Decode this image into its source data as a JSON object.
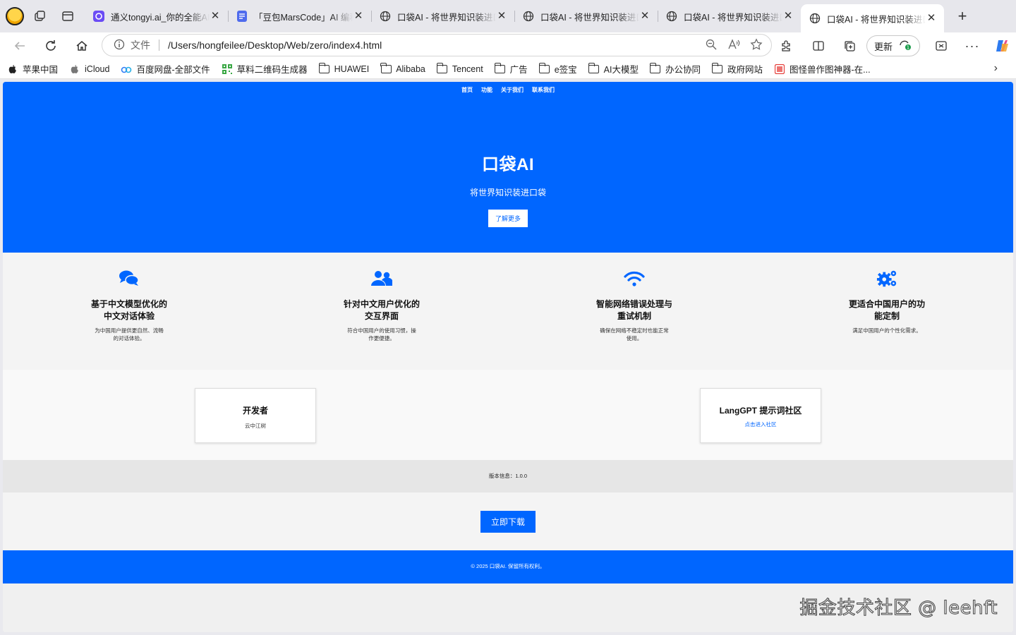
{
  "browser": {
    "tabs": [
      {
        "title": "通义tongyi.ai_你的全能AI助手",
        "favicon": "tongyi-icon",
        "active": false
      },
      {
        "title": "「豆包MarsCode」AI 编程助手",
        "favicon": "doc-icon",
        "active": false
      },
      {
        "title": "口袋AI - 将世界知识装进口袋",
        "favicon": "globe-icon",
        "active": false
      },
      {
        "title": "口袋AI - 将世界知识装进口袋",
        "favicon": "globe-icon",
        "active": false
      },
      {
        "title": "口袋AI - 将世界知识装进口袋",
        "favicon": "globe-icon",
        "active": false
      },
      {
        "title": "口袋AI - 将世界知识装进口袋",
        "favicon": "globe-icon",
        "active": true
      }
    ],
    "address": {
      "scheme_label": "文件",
      "url": "/Users/hongfeilee/Desktop/Web/zero/index4.html"
    },
    "update_label": "更新",
    "bookmarks": [
      {
        "label": "苹果中国",
        "icon": "apple-icon"
      },
      {
        "label": "iCloud",
        "icon": "apple-icon"
      },
      {
        "label": "百度网盘-全部文件",
        "icon": "baidu-pan-icon"
      },
      {
        "label": "草料二维码生成器",
        "icon": "qrcode-icon"
      },
      {
        "label": "HUAWEI",
        "icon": "folder-icon"
      },
      {
        "label": "Alibaba",
        "icon": "folder-icon"
      },
      {
        "label": "Tencent",
        "icon": "folder-icon"
      },
      {
        "label": "广告",
        "icon": "folder-icon"
      },
      {
        "label": "e签宝",
        "icon": "folder-icon"
      },
      {
        "label": "AI大模型",
        "icon": "folder-icon"
      },
      {
        "label": "办公协同",
        "icon": "folder-icon"
      },
      {
        "label": "政府网站",
        "icon": "folder-icon"
      },
      {
        "label": "图怪兽作图神器-在...",
        "icon": "tuguaishou-icon"
      }
    ]
  },
  "page": {
    "nav": [
      "首页",
      "功能",
      "关于我们",
      "联系我们"
    ],
    "hero": {
      "title": "口袋AI",
      "subtitle": "将世界知识装进口袋",
      "button": "了解更多"
    },
    "features": [
      {
        "icon": "chat-bubbles-icon",
        "title": "基于中文模型优化的中文对话体验",
        "desc": "为中国用户提供更自然、流畅的对话体验。"
      },
      {
        "icon": "users-icon",
        "title": "针对中文用户优化的交互界面",
        "desc": "符合中国用户的使用习惯，操作更便捷。"
      },
      {
        "icon": "wifi-icon",
        "title": "智能网络错误处理与重试机制",
        "desc": "确保在网络不稳定时也能正常使用。"
      },
      {
        "icon": "gears-icon",
        "title": "更适合中国用户的功能定制",
        "desc": "满足中国用户的个性化需求。"
      }
    ],
    "cards": {
      "developer": {
        "title": "开发者",
        "sub": "云中江树"
      },
      "community": {
        "title": "LangGPT 提示词社区",
        "link": "点击进入社区"
      }
    },
    "version": "版本信息：1.0.0",
    "download": "立即下载",
    "footer": "© 2025 口袋AI. 保留所有权利。"
  },
  "watermark": "掘金技术社区 @ leehft",
  "colors": {
    "primary": "#0066ff",
    "chrome_bg": "#e7e7ec"
  }
}
